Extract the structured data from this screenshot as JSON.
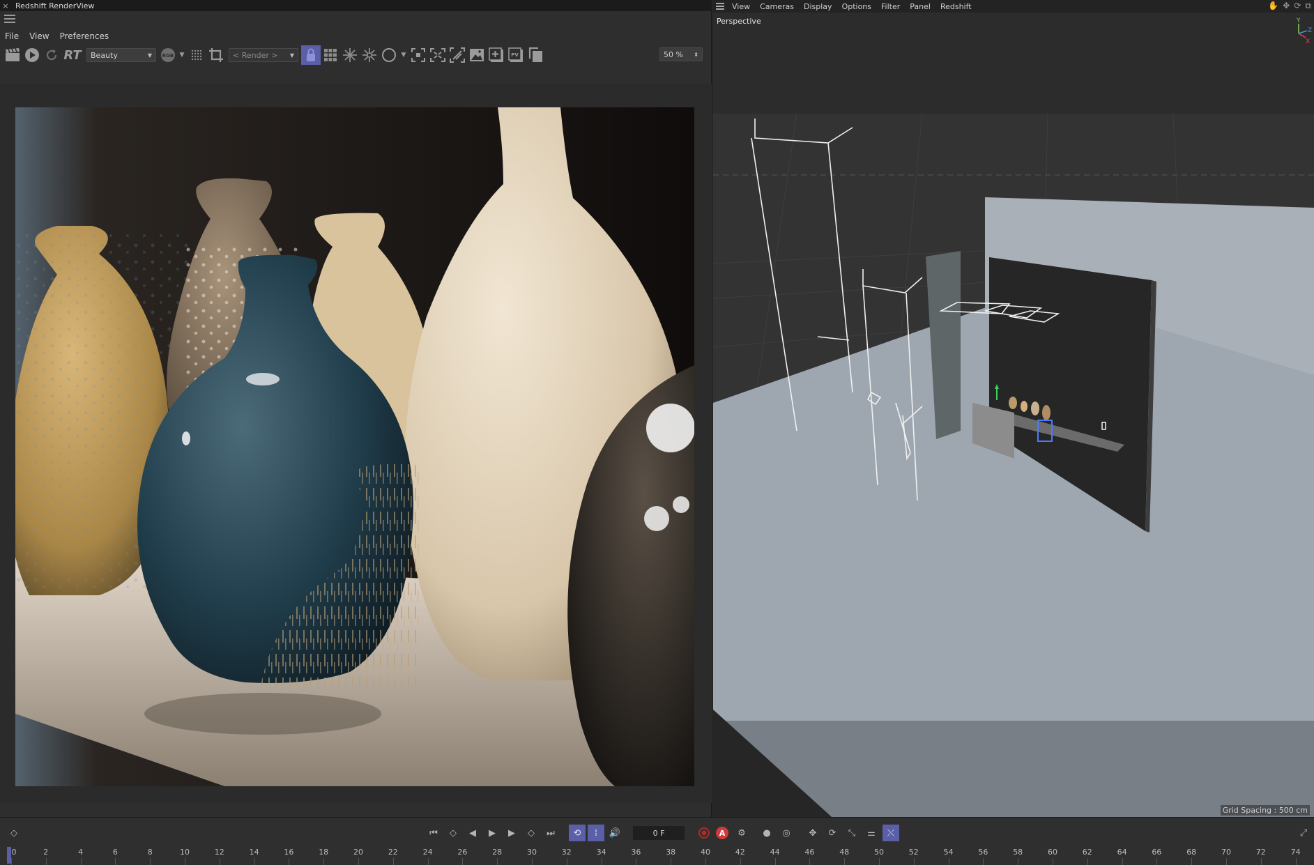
{
  "render_view": {
    "window_title": "Redshift RenderView",
    "close_glyph": "×",
    "menu": [
      "File",
      "View",
      "Preferences"
    ],
    "toolbar": {
      "rt_label": "RT",
      "aov_select": "Beauty",
      "channel_badge": "RGB",
      "camera_select": "< Render >",
      "pv_label": "PV",
      "zoom_value": "50 %"
    }
  },
  "viewport": {
    "menu": [
      "View",
      "Cameras",
      "Display",
      "Options",
      "Filter",
      "Panel",
      "Redshift"
    ],
    "view_label": "Perspective",
    "grid_spacing": "Grid Spacing : 500 cm",
    "axis_labels": {
      "y": "Y",
      "z": "Z",
      "x": "X"
    }
  },
  "timeline": {
    "current_frame": "0 F",
    "record_label": "A",
    "ruler_ticks": [
      "0",
      "2",
      "4",
      "6",
      "8",
      "10",
      "12",
      "14",
      "16",
      "18",
      "20",
      "22",
      "24",
      "26",
      "28",
      "30",
      "32",
      "34",
      "36",
      "38",
      "40",
      "42",
      "44",
      "46",
      "48",
      "50",
      "52",
      "54",
      "56",
      "58",
      "60",
      "62",
      "64",
      "66",
      "68",
      "70",
      "72",
      "74"
    ]
  },
  "colors": {
    "accent": "#5a5fa8",
    "panel_bg": "#2e2e2e",
    "title_bg": "#1b1b1b"
  }
}
